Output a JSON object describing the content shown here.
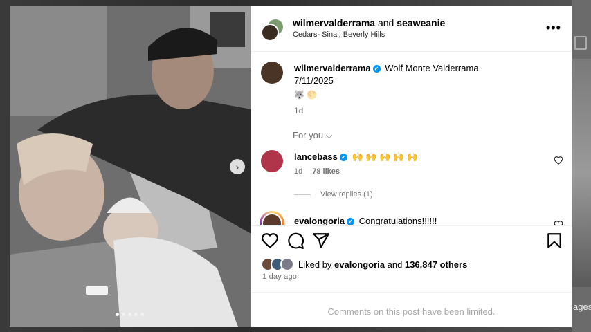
{
  "background": {
    "partial_text": "ages"
  },
  "photo": {
    "next_glyph": "›",
    "carousel_total": 5,
    "carousel_active": 1
  },
  "header": {
    "user1": "wilmervalderrama",
    "joiner": "and",
    "user2": "seaweanie",
    "location": "Cedars- Sinai, Beverly Hills",
    "more_glyph": "•••"
  },
  "caption": {
    "username": "wilmervalderrama",
    "verified_glyph": "✓",
    "text": "Wolf Monte Valderrama",
    "date": "7/11/2025",
    "emoji": "🐺 🌕",
    "time": "1d"
  },
  "for_you": "For you ⌵",
  "comments": [
    {
      "username": "lancebass",
      "text": "🙌 🙌 🙌 🙌 🙌",
      "time": "1d",
      "likes": "78 likes",
      "view_replies": "View replies (1)"
    },
    {
      "username": "evalongoria",
      "text": "Congratulations!!!!!!"
    }
  ],
  "likes": {
    "prefix": "Liked by",
    "user": "evalongoria",
    "suffix": "and",
    "count": "136,847 others"
  },
  "posted": "1 day ago",
  "footer": {
    "limited": "Comments on this post have been limited."
  },
  "colors": {
    "verified": "#0095f6",
    "muted": "#737373"
  },
  "icons": [
    "heart-icon",
    "comment-icon",
    "share-icon",
    "bookmark-icon",
    "more-icon",
    "chevron-right-icon"
  ]
}
